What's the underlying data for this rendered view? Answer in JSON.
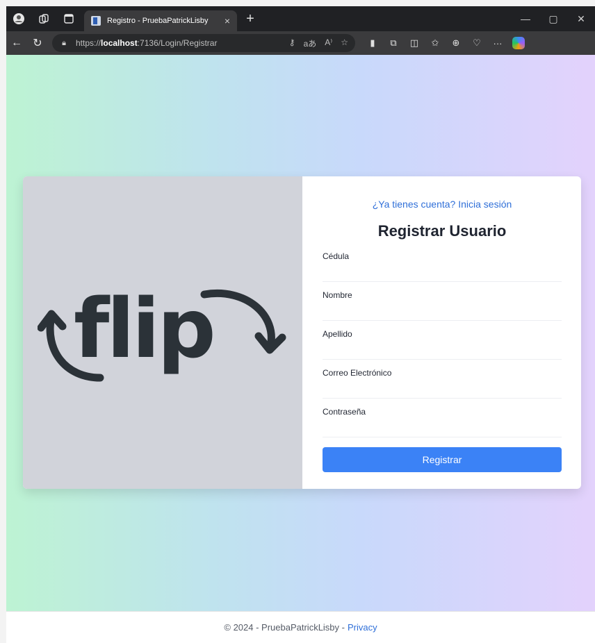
{
  "browser": {
    "tab_title": "Registro - PruebaPatrickLisby",
    "tab_close": "×",
    "new_tab": "+",
    "url_prefix": "https://",
    "url_host": "localhost",
    "url_rest": ":7136/Login/Registrar",
    "ellipsis": "···"
  },
  "logo": {
    "text": "flip"
  },
  "form": {
    "login_link": "¿Ya tienes cuenta? Inicia sesión",
    "title": "Registrar Usuario",
    "fields": [
      {
        "label": "Cédula",
        "value": ""
      },
      {
        "label": "Nombre",
        "value": ""
      },
      {
        "label": "Apellido",
        "value": ""
      },
      {
        "label": "Correo Electrónico",
        "value": ""
      },
      {
        "label": "Contraseña",
        "value": ""
      }
    ],
    "submit_label": "Registrar"
  },
  "footer": {
    "copyright": "© 2024 - PruebaPatrickLisby -",
    "privacy_label": "Privacy"
  }
}
